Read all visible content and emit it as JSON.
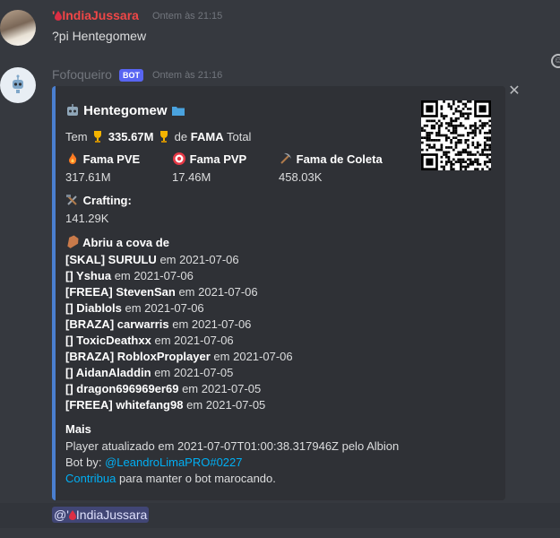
{
  "user_message": {
    "username_prefix": "'",
    "username": "IndiaJussara",
    "timestamp": "Ontem às 21:15",
    "text": "?pi Hentegomew"
  },
  "bot_message": {
    "username": "Fofoqueiro",
    "bot_tag": "BOT",
    "timestamp": "Ontem às 21:16"
  },
  "embed": {
    "title": "Hentegomew",
    "fame_prefix": "Tem",
    "fame_total_value": "335.67M",
    "fame_middle": "de",
    "fame_word": "FAMA",
    "fame_suffix": "Total",
    "fields": [
      {
        "name": "Fama PVE",
        "value": "317.61M",
        "icon": "fire-icon"
      },
      {
        "name": "Fama PVP",
        "value": "17.46M",
        "icon": "target-icon"
      },
      {
        "name": "Fama de Coleta",
        "value": "458.03K",
        "icon": "pick-icon"
      }
    ],
    "crafting": {
      "name": "Crafting:",
      "value": "141.29K",
      "icon": "hammer-wrench-icon"
    },
    "graves_title": "Abriu a cova de",
    "graves": [
      {
        "tag": "[SKAL] SURULU",
        "date": "2021-07-06"
      },
      {
        "tag": "[] Yshua",
        "date": "2021-07-06"
      },
      {
        "tag": "[FREEA] StevenSan",
        "date": "2021-07-06"
      },
      {
        "tag": "[] Diablols",
        "date": "2021-07-06"
      },
      {
        "tag": "[BRAZA] carwarris",
        "date": "2021-07-06"
      },
      {
        "tag": "[] ToxicDeathxx",
        "date": "2021-07-06"
      },
      {
        "tag": "[BRAZA] RobloxProplayer",
        "date": "2021-07-06"
      },
      {
        "tag": "[] AidanAladdin",
        "date": "2021-07-05"
      },
      {
        "tag": "[] dragon696969er69",
        "date": "2021-07-05"
      },
      {
        "tag": "[FREEA] whitefang98",
        "date": "2021-07-05"
      }
    ],
    "graves_em": "em",
    "mais_title": "Mais",
    "updated_text": "Player atualizado em 2021-07-07T01:00:38.317946Z pelo Albion",
    "bot_by_label": "Bot by:",
    "bot_by_link": "@LeandroLimaPRO#0227",
    "contribua_link": "Contribua",
    "contribua_text": "para manter o bot marocando."
  },
  "mention": {
    "prefix": "@'",
    "name": "IndiaJussara"
  },
  "colors": {
    "background": "#36393f",
    "embed_bg": "#2f3136",
    "embed_border": "#4a7fd0",
    "username_user": "#f04747",
    "username_bot": "#72767d",
    "link": "#00aff4",
    "bot_tag": "#5865f2"
  }
}
